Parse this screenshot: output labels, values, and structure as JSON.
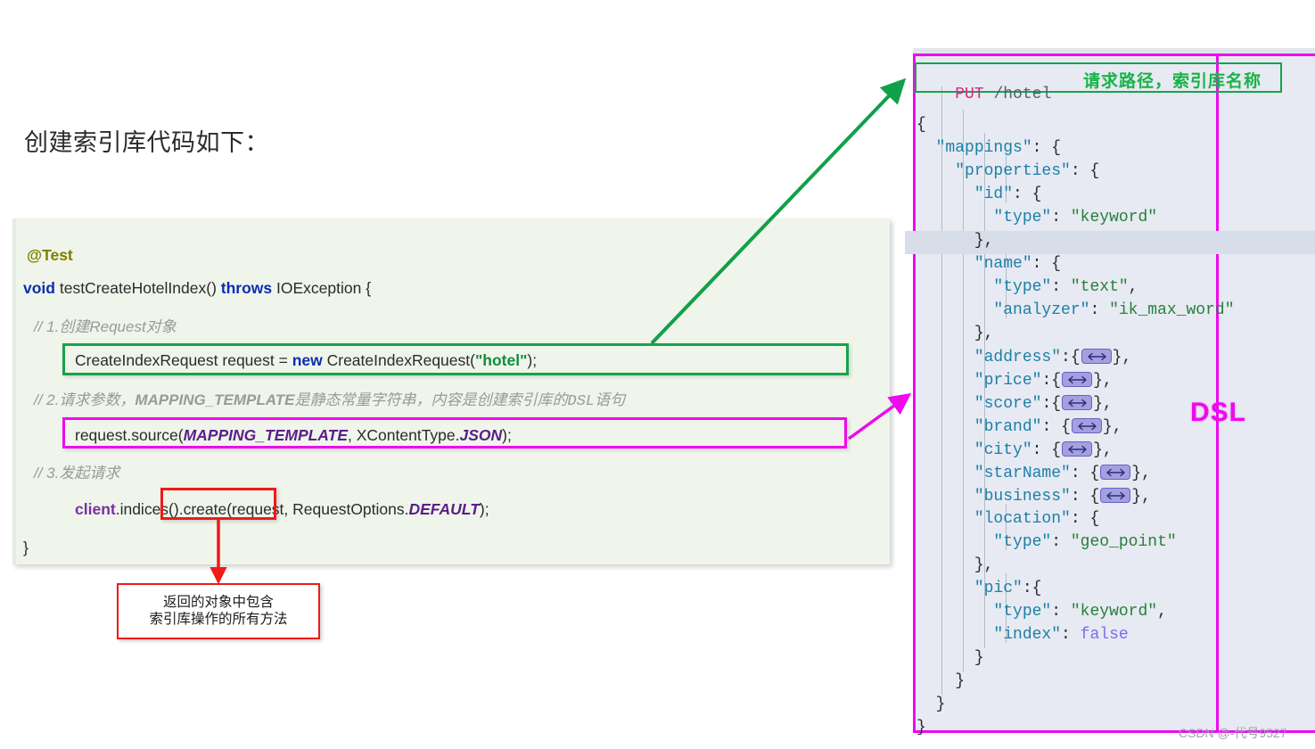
{
  "heading": "创建索引库代码如下：",
  "java_code": {
    "annotation": "@Test",
    "signature_kw1": "void",
    "signature_name": " testCreateHotelIndex() ",
    "signature_kw2": "throws",
    "signature_tail": " IOException {",
    "comment1": "// 1.创建Request对象",
    "line1_a": "CreateIndexRequest request = ",
    "line1_kw": "new",
    "line1_b": " CreateIndexRequest(",
    "line1_str": "\"hotel\"",
    "line1_c": ");",
    "comment2_a": "// 2.请求参数，",
    "comment2_b": "MAPPING_TEMPLATE",
    "comment2_c": "是静态常量字符串，内容是创建索引库的",
    "comment2_d": "DSL",
    "comment2_e": "语句",
    "line2_a": "request.source(",
    "line2_b": "MAPPING_TEMPLATE",
    "line2_c": ", XContentType.",
    "line2_d": "JSON",
    "line2_e": ");",
    "comment3": "// 3.发起请求",
    "line3_a": "client",
    "line3_b": ".indices().create(request, RequestOptions.",
    "line3_c": "DEFAULT",
    "line3_d": ");",
    "closing_brace": "}"
  },
  "callout": {
    "line1": "返回的对象中包含",
    "line2": "索引库操作的所有方法"
  },
  "dsl_panel": {
    "request_verb": "PUT",
    "request_path": "/hotel",
    "put_label": "请求路径，索引库名称",
    "dsl_word": "DSL",
    "lines": [
      "{",
      "  \"mappings\": {",
      "    \"properties\": {",
      "      \"id\": {",
      "        \"type\": \"keyword\"",
      "      },",
      "      \"name\": {",
      "        \"type\": \"text\",",
      "        \"analyzer\": \"ik_max_word\"",
      "      },",
      "      \"address\":{FOLD},",
      "      \"price\":{FOLD},",
      "      \"score\":{FOLD},",
      "      \"brand\": {FOLD},",
      "      \"city\": {FOLD},",
      "      \"starName\": {FOLD},",
      "      \"business\": {FOLD},",
      "      \"location\": {",
      "        \"type\": \"geo_point\"",
      "      },",
      "      \"pic\":{",
      "        \"type\": \"keyword\",",
      "        \"index\": false",
      "      }",
      "    }",
      "  }",
      "}"
    ]
  },
  "watermark": "CSDN @-代号9527",
  "colors": {
    "code_card_bg": "#eff5ea",
    "dsl_panel_bg": "#e7eaf2",
    "green_accent": "#16a34a",
    "magenta_accent": "#ef09ef",
    "red_accent": "#f01a1a",
    "annotation": "#808000",
    "keyword_blue": "#0c2eb0",
    "string_green": "#118c3b",
    "comment_gray": "#9a9a9a",
    "json_key": "#1c7fa8",
    "json_string": "#27803a",
    "json_bool": "#7d6cf0",
    "verb_pink": "#e0218a",
    "fold_fill": "#a3a0e0",
    "caret_row": "#d7dde9"
  }
}
